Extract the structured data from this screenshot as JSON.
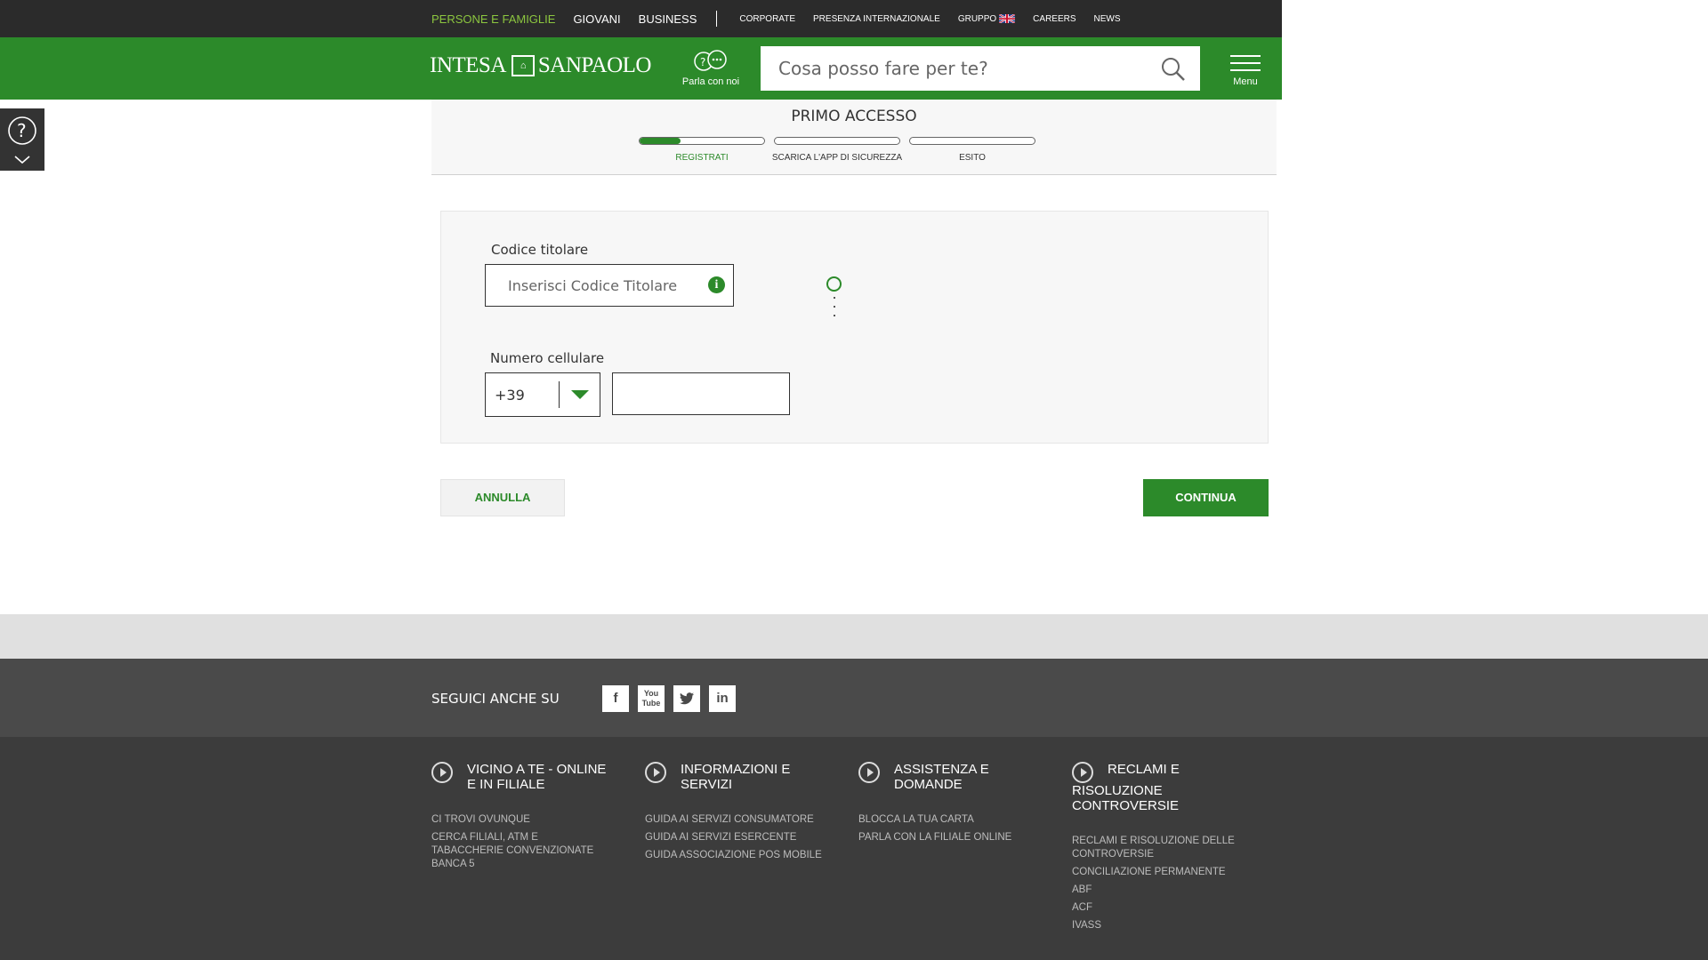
{
  "topnav": {
    "main": [
      "PERSONE E FAMIGLIE",
      "GIOVANI",
      "BUSINESS"
    ],
    "secondary": [
      "CORPORATE",
      "PRESENZA INTERNAZIONALE",
      "GRUPPO",
      "CAREERS",
      "NEWS"
    ]
  },
  "header": {
    "logo_left": "INTESA",
    "logo_right": "SANPAOLO",
    "talk_label": "Parla con noi",
    "search_placeholder": "Cosa posso fare per te?",
    "menu_label": "Menu"
  },
  "steps": {
    "title": "PRIMO ACCESSO",
    "items": [
      {
        "label": "REGISTRATI",
        "progress": 0.33
      },
      {
        "label": "SCARICA L'APP DI SICUREZZA",
        "progress": 0
      },
      {
        "label": "ESITO",
        "progress": 0
      }
    ]
  },
  "form": {
    "codice_label": "Codice titolare",
    "codice_placeholder": "Inserisci Codice Titolare",
    "cellulare_label": "Numero cellulare",
    "prefix_value": "+39",
    "phone_value": ""
  },
  "buttons": {
    "cancel": "ANNULLA",
    "continue": "CONTINUA"
  },
  "social": {
    "follow_label": "SEGUICI ANCHE SU"
  },
  "footer": {
    "columns": [
      {
        "title": "VICINO A TE - ONLINE E IN FILIALE",
        "links": [
          "CI TROVI OVUNQUE",
          "CERCA FILIALI, ATM E TABACCHERIE CONVENZIONATE BANCA 5"
        ]
      },
      {
        "title": "INFORMAZIONI E SERVIZI",
        "links": [
          "GUIDA AI SERVIZI CONSUMATORE",
          "GUIDA AI SERVIZI ESERCENTE",
          "GUIDA ASSOCIAZIONE POS MOBILE"
        ]
      },
      {
        "title": "ASSISTENZA E DOMANDE",
        "links": [
          "BLOCCA LA TUA CARTA",
          "PARLA CON LA FILIALE ONLINE"
        ]
      },
      {
        "title": "RECLAMI E RISOLUZIONE CONTROVERSIE",
        "links": [
          "RECLAMI E RISOLUZIONE DELLE CONTROVERSIE",
          "CONCILIAZIONE PERMANENTE",
          "ABF",
          "ACF",
          "IVASS"
        ]
      }
    ]
  },
  "colors": {
    "brand_green": "#2c8a2a",
    "active_nav": "#8cc63f",
    "topbar": "#2b2b2b"
  }
}
